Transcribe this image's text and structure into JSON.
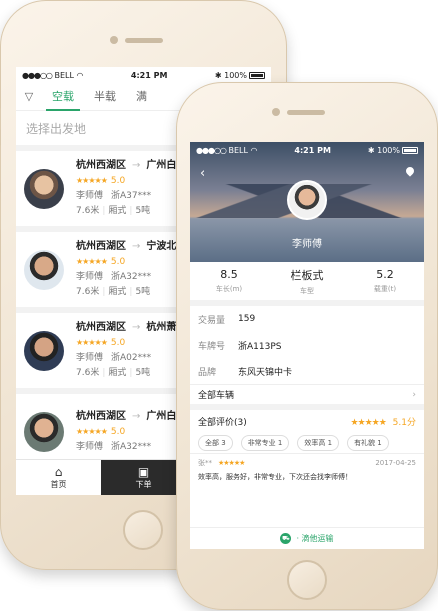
{
  "back": {
    "status": {
      "carrier": "BELL",
      "time": "4:21 PM",
      "battery": "100%"
    },
    "tabs": [
      "空载",
      "半载",
      "满"
    ],
    "origin_placeholder": "选择出发地",
    "cards": [
      {
        "from": "杭州西湖区",
        "to": "广州白",
        "score": "5.0",
        "driver": "李师傅",
        "plate": "浙A37***",
        "length": "7.6米",
        "body": "厢式",
        "weight": "5吨"
      },
      {
        "from": "杭州西湖区",
        "to": "宁波北",
        "score": "5.0",
        "driver": "李师傅",
        "plate": "浙A32***",
        "length": "7.6米",
        "body": "厢式",
        "weight": "5吨"
      },
      {
        "from": "杭州西湖区",
        "to": "杭州萧",
        "score": "5.0",
        "driver": "李师傅",
        "plate": "浙A02***",
        "length": "7.6米",
        "body": "厢式",
        "weight": "5吨"
      },
      {
        "from": "杭州西湖区",
        "to": "广州白",
        "score": "5.0",
        "driver": "李师傅",
        "plate": "浙A32***",
        "length": "7.6米",
        "body": "",
        "weight": ""
      }
    ],
    "nav": [
      "首页",
      "下单",
      "运单"
    ]
  },
  "front": {
    "status": {
      "carrier": "BELL",
      "time": "4:21 PM",
      "battery": "100%"
    },
    "driver_name": "李师傅",
    "stats": [
      {
        "value": "8.5",
        "label": "车长(m)"
      },
      {
        "value": "栏板式",
        "label": "车型"
      },
      {
        "value": "5.2",
        "label": "载重(t)"
      }
    ],
    "rows": [
      {
        "label": "交易量",
        "value": "159"
      },
      {
        "label": "车牌号",
        "value": "浙A113PS"
      },
      {
        "label": "品牌",
        "value": "东风天锦中卡"
      }
    ],
    "all_vehicles": "全部车辆",
    "reviews_title": "全部评价(3)",
    "reviews_score": "5.1分",
    "chips": [
      "全部  3",
      "非常专业  1",
      "效率高  1",
      "有礼貌  1"
    ],
    "review": {
      "user": "张**",
      "date": "2017-04-25",
      "text": "效率高，服务好，非常专业，下次还会找李师傅！"
    },
    "contact": "·  滴他运输"
  }
}
